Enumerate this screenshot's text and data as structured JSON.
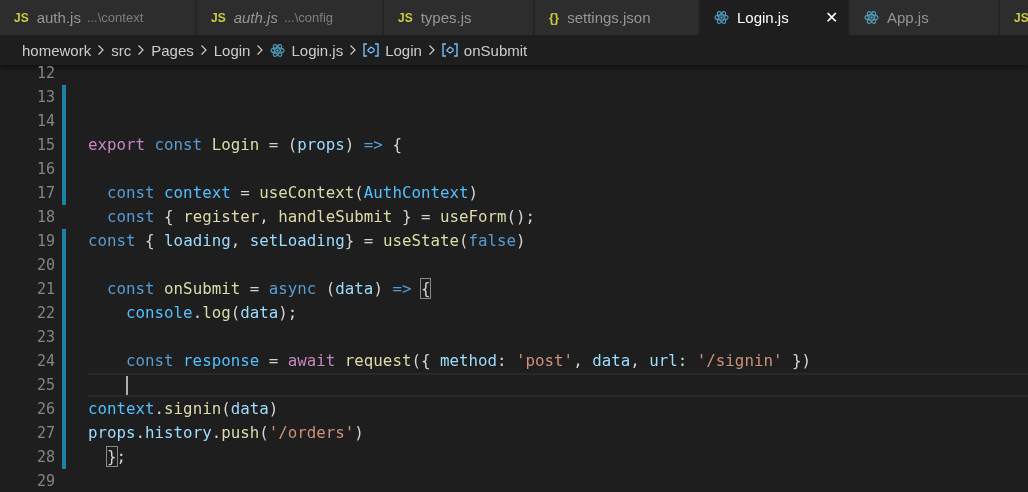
{
  "tabs": [
    {
      "kind": "text",
      "icon": "JS",
      "label": "auth.js",
      "description": "...\\context",
      "italic": false,
      "selected": false
    },
    {
      "kind": "text",
      "icon": "JS",
      "label": "auth.js",
      "description": "...\\config",
      "italic": true,
      "selected": false
    },
    {
      "kind": "text",
      "icon": "JS",
      "label": "types.js",
      "italic": false,
      "selected": false
    },
    {
      "kind": "braces",
      "icon": "{}",
      "label": "settings.json",
      "italic": false,
      "selected": false
    },
    {
      "kind": "react",
      "label": "Login.js",
      "italic": false,
      "selected": true,
      "close": "✕"
    },
    {
      "kind": "react",
      "label": "App.js",
      "italic": false,
      "selected": false
    },
    {
      "kind": "text",
      "icon": "JS",
      "selected": false
    }
  ],
  "breadcrumb": [
    {
      "kind": "folder",
      "label": "homework"
    },
    {
      "kind": "folder",
      "label": "src"
    },
    {
      "kind": "folder",
      "label": "Pages"
    },
    {
      "kind": "folder",
      "label": "Login"
    },
    {
      "kind": "react",
      "label": "Login.js"
    },
    {
      "kind": "symbol",
      "label": "Login"
    },
    {
      "kind": "symbol",
      "label": "onSubmit"
    }
  ],
  "lines": [
    {
      "number": "12",
      "modified": false
    },
    {
      "number": "13",
      "modified": true
    },
    {
      "number": "14",
      "modified": true
    },
    {
      "number": "15",
      "modified": true,
      "tokens": [
        {
          "kw": "export "
        },
        {
          "st": "const "
        },
        {
          "fn": "Login"
        },
        {
          "p": " = ("
        },
        {
          "var": "props"
        },
        {
          "p": ") "
        },
        {
          "st": "=> "
        },
        {
          "p": "{"
        }
      ]
    },
    {
      "number": "16",
      "modified": true
    },
    {
      "number": "17",
      "modified": true,
      "tokens": [
        {
          "st": "  const "
        },
        {
          "cn": "context"
        },
        {
          "p": " = "
        },
        {
          "fn": "useContext"
        },
        {
          "p": "("
        },
        {
          "cn": "AuthContext"
        },
        {
          "p": ")"
        }
      ]
    },
    {
      "number": "18",
      "modified": false,
      "tokens": [
        {
          "st": "  const"
        },
        {
          "p": " { "
        },
        {
          "fn": "register"
        },
        {
          "p": ", "
        },
        {
          "fn": "handleSubmit"
        },
        {
          "p": " } = "
        },
        {
          "fn": "useForm"
        },
        {
          "p": "();"
        }
      ]
    },
    {
      "number": "19",
      "modified": true,
      "tokens": [
        {
          "st": "const"
        },
        {
          "p": " { "
        },
        {
          "var": "loading"
        },
        {
          "p": ", "
        },
        {
          "var": "setLoading"
        },
        {
          "p": "} = "
        },
        {
          "fn": "useState"
        },
        {
          "p": "("
        },
        {
          "st": "false"
        },
        {
          "p": ")"
        }
      ]
    },
    {
      "number": "20",
      "modified": true
    },
    {
      "number": "21",
      "modified": true,
      "tokens": [
        {
          "st": "  const "
        },
        {
          "fn": "onSubmit"
        },
        {
          "p": " = "
        },
        {
          "st": "async"
        },
        {
          "p": " ("
        },
        {
          "var": "data"
        },
        {
          "p": ") "
        },
        {
          "st": "=> "
        },
        {
          "match": "{"
        }
      ]
    },
    {
      "number": "22",
      "modified": true,
      "tokens": [
        {
          "cn": "    console"
        },
        {
          "p": "."
        },
        {
          "fn": "log"
        },
        {
          "p": "("
        },
        {
          "var": "data"
        },
        {
          "p": ");"
        }
      ]
    },
    {
      "number": "23",
      "modified": true
    },
    {
      "number": "24",
      "modified": true,
      "tokens": [
        {
          "st": "    const "
        },
        {
          "cn": "response"
        },
        {
          "p": " = "
        },
        {
          "kw": "await "
        },
        {
          "fn": "request"
        },
        {
          "p": "({ "
        },
        {
          "var": "method"
        },
        {
          "p": ": "
        },
        {
          "str": "'post'"
        },
        {
          "p": ", "
        },
        {
          "var": "data"
        },
        {
          "p": ", "
        },
        {
          "var": "url"
        },
        {
          "p": ": "
        },
        {
          "str": "'/signin'"
        },
        {
          "p": " })"
        }
      ]
    },
    {
      "number": "25",
      "modified": true,
      "current": true
    },
    {
      "number": "26",
      "modified": true,
      "tokens": [
        {
          "cn": "context"
        },
        {
          "p": "."
        },
        {
          "fn": "signin"
        },
        {
          "p": "("
        },
        {
          "var": "data"
        },
        {
          "p": ")"
        }
      ]
    },
    {
      "number": "27",
      "modified": true,
      "tokens": [
        {
          "var": "props"
        },
        {
          "p": "."
        },
        {
          "var": "history"
        },
        {
          "p": "."
        },
        {
          "fn": "push"
        },
        {
          "p": "("
        },
        {
          "str": "'/orders'"
        },
        {
          "p": ")"
        }
      ]
    },
    {
      "number": "28",
      "modified": true,
      "tokens": [
        {
          "match": "  }"
        },
        {
          "p": ";"
        }
      ]
    },
    {
      "number": "29",
      "modified": false
    }
  ]
}
